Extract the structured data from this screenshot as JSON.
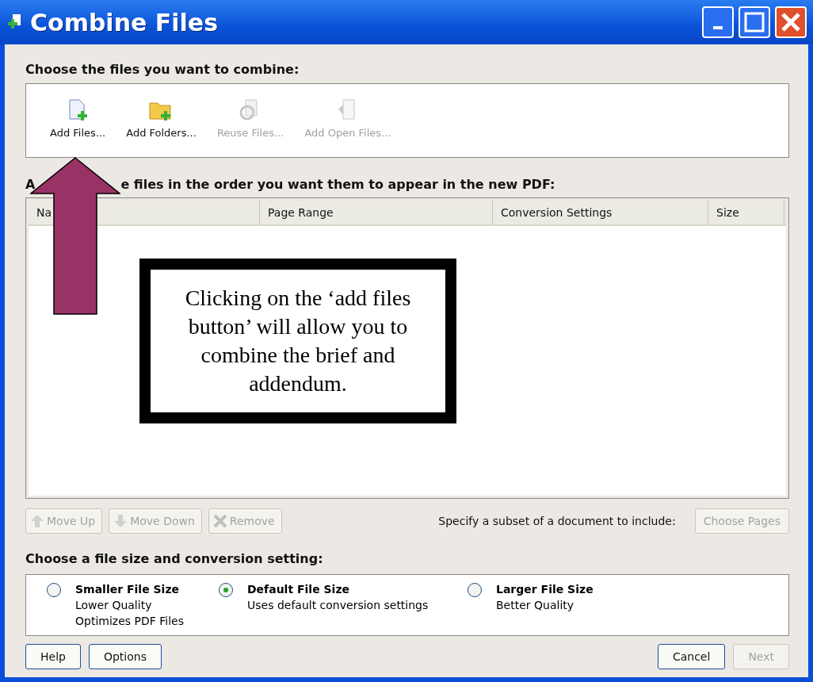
{
  "window": {
    "title": "Combine Files"
  },
  "files_section": {
    "heading": "Choose the files you want to combine:",
    "actions": [
      {
        "label": "Add Files...",
        "disabled": false,
        "kind": "file"
      },
      {
        "label": "Add Folders...",
        "disabled": false,
        "kind": "folder"
      },
      {
        "label": "Reuse Files...",
        "disabled": true,
        "kind": "reuse"
      },
      {
        "label": "Add Open Files...",
        "disabled": true,
        "kind": "open"
      }
    ]
  },
  "list_section": {
    "heading_parts": [
      "A",
      "e files in the order you want them to appear in the new PDF:"
    ],
    "columns": [
      "Na",
      "Page Range",
      "Conversion Settings",
      "Size"
    ],
    "buttons": [
      {
        "label": "Move Up",
        "disabled": true,
        "kind": "up"
      },
      {
        "label": "Move Down",
        "disabled": true,
        "kind": "down"
      },
      {
        "label": "Remove",
        "disabled": true,
        "kind": "remove"
      }
    ],
    "subset_label": "Specify a subset of a document to include:",
    "choose_pages": {
      "label": "Choose Pages",
      "disabled": true
    }
  },
  "size_section": {
    "heading": "Choose a file size and conversion setting:",
    "options": [
      {
        "title": "Smaller File Size",
        "lines": [
          "Lower Quality",
          "Optimizes PDF Files"
        ],
        "selected": false
      },
      {
        "title": "Default File Size",
        "lines": [
          "Uses default conversion settings"
        ],
        "selected": true
      },
      {
        "title": "Larger File Size",
        "lines": [
          "Better Quality"
        ],
        "selected": false
      }
    ]
  },
  "footer": {
    "left": [
      {
        "label": "Help",
        "disabled": false
      },
      {
        "label": "Options",
        "disabled": false
      }
    ],
    "right": [
      {
        "label": "Cancel",
        "disabled": false
      },
      {
        "label": "Next",
        "disabled": true
      }
    ]
  },
  "callout": {
    "text": "Clicking on the ‘add files button’ will allow you to combine the brief and addendum."
  }
}
